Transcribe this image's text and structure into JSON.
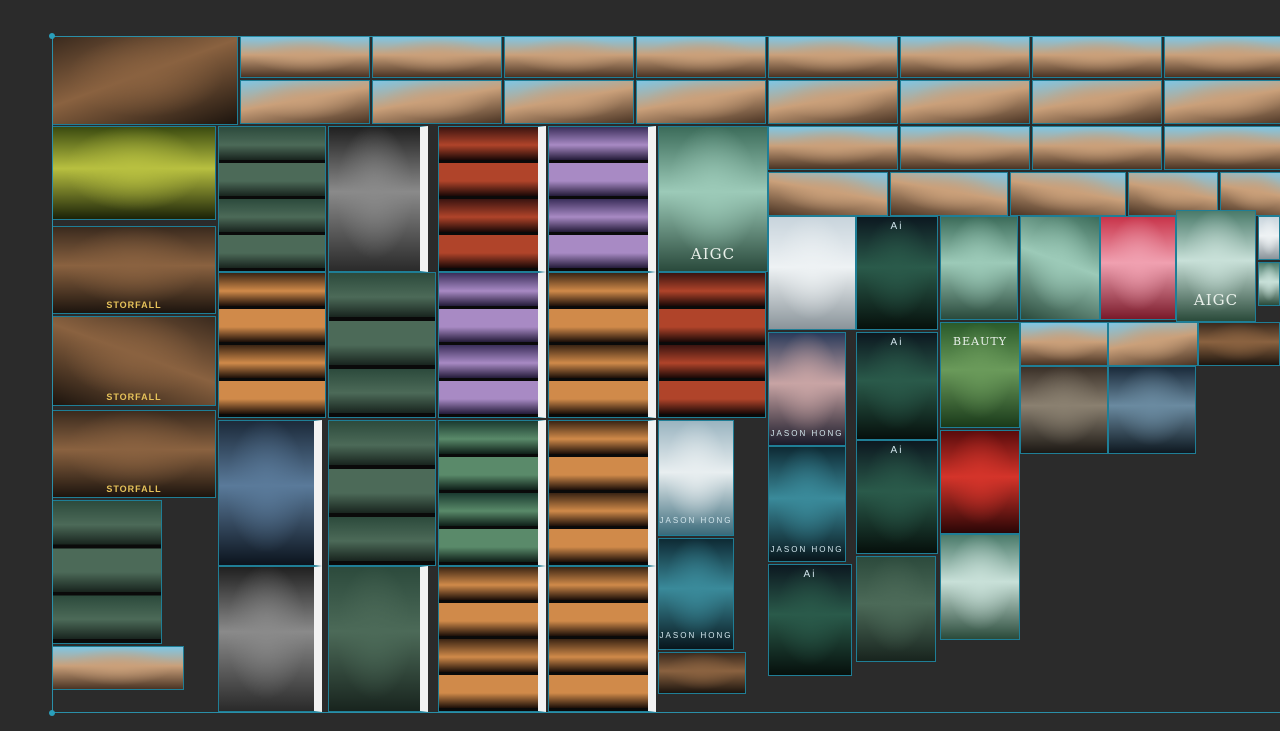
{
  "canvas": {
    "background": "#2b2b2b",
    "selection_color": "#2a8fa8"
  },
  "overlays": {
    "aigc": "AIGC",
    "jason_hong": "JASON HONG",
    "beauty": "BEAUTY",
    "storfall": "STORFALL",
    "ai": "Ai"
  },
  "palettes": {
    "sky": [
      "#7fc6e4",
      "#caa07a",
      "#4a3424"
    ],
    "forest": [
      "#2c4a3c",
      "#4c6a58",
      "#18241e"
    ],
    "cave": [
      "#3a2a1e",
      "#8a6240",
      "#1c140e"
    ],
    "grey_temple": [
      "#202020",
      "#8a8a8a",
      "#2a2a2a"
    ],
    "red_hall": [
      "#3a1410",
      "#b0442a",
      "#180806"
    ],
    "purple": [
      "#3a2e5a",
      "#a88ac4",
      "#231a38"
    ],
    "orange": [
      "#3a2414",
      "#d08a4a",
      "#1a0e08"
    ],
    "mist_blue": [
      "#1c2a3a",
      "#5a7a9a",
      "#0c141e"
    ],
    "mystic_green": [
      "#1a3a30",
      "#5a8a6a",
      "#0e1e18"
    ],
    "pale_green": [
      "#3c6c5a",
      "#9ccab8",
      "#2a4a3c"
    ],
    "snow": [
      "#c8d4dc",
      "#eef2f4",
      "#8a949a"
    ],
    "dark_tower": [
      "#0c1820",
      "#2a5a4a",
      "#06100c"
    ],
    "sunset": [
      "#2a3a5a",
      "#c8a4a4",
      "#1a1a2a"
    ],
    "teal_pool": [
      "#0e2a34",
      "#3a8a9a",
      "#08161c"
    ],
    "green_lady": [
      "#2a5a2a",
      "#6a9a5a",
      "#1a3a1a"
    ],
    "pink_lion": [
      "#c8344a",
      "#f0a0b0",
      "#7a1a2a"
    ],
    "red_gate": [
      "#5a0c0c",
      "#d4342a",
      "#2a0606"
    ],
    "glass": [
      "#4a7a6a",
      "#c8e0d8",
      "#2a4a3a"
    ],
    "stone_dome": [
      "#1a2a3a",
      "#6a8aa0",
      "#0e1820"
    ],
    "warrior": [
      "#3a3028",
      "#8a8070",
      "#1c1814"
    ],
    "yellow_tech": [
      "#3a4a10",
      "#b8c040",
      "#1a2208"
    ],
    "white_pool": [
      "#9ab4c0",
      "#e8eef0",
      "#3a6a7a"
    ],
    "dark_frame": [
      "#101010",
      "#3a3a3a",
      "#080808"
    ]
  }
}
